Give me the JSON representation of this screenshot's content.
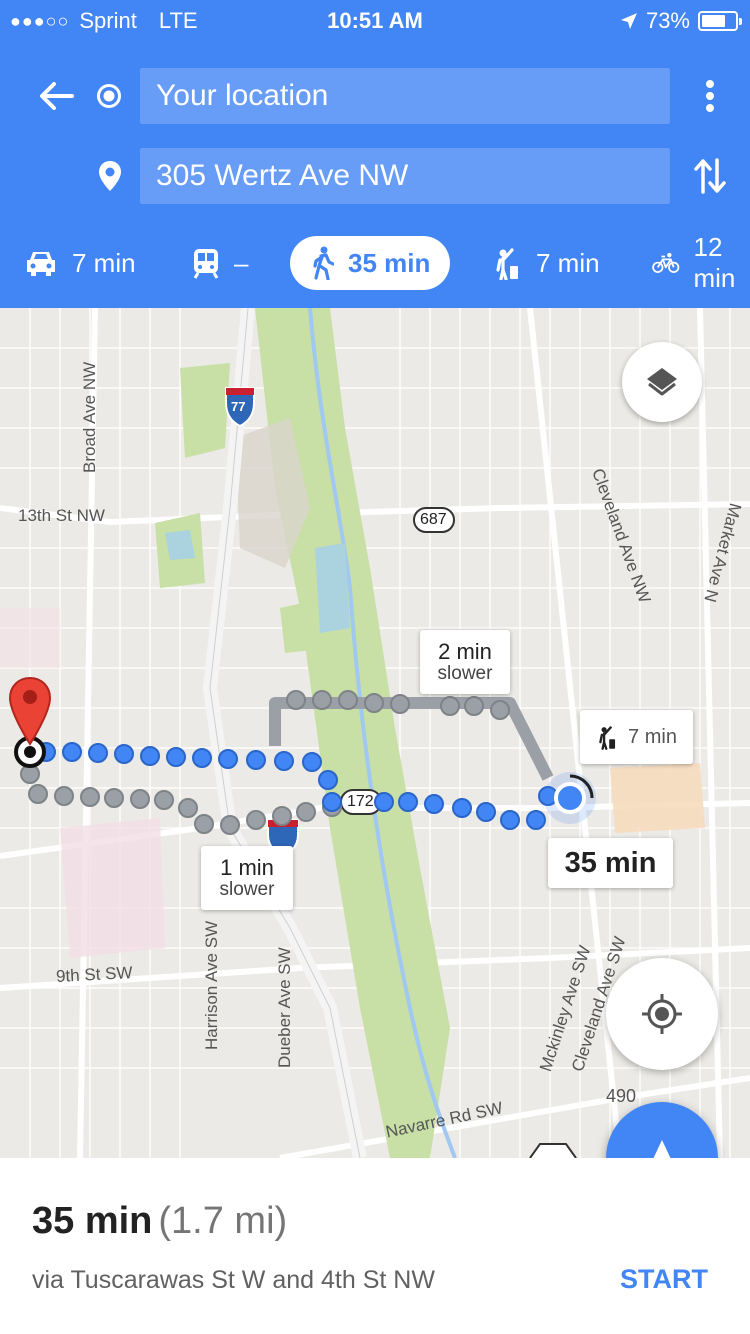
{
  "status_bar": {
    "carrier": "Sprint",
    "network": "LTE",
    "time": "10:51 AM",
    "battery": "73%",
    "battery_level": 0.73
  },
  "directions": {
    "origin": "Your location",
    "destination": "305 Wertz Ave NW"
  },
  "modes": [
    {
      "icon": "car-icon",
      "label": "7 min"
    },
    {
      "icon": "transit-icon",
      "label": "–"
    },
    {
      "icon": "walk-icon",
      "label": "35 min",
      "active": true
    },
    {
      "icon": "ride-icon",
      "label": "7 min"
    },
    {
      "icon": "bike-icon",
      "label": "12 min"
    }
  ],
  "map": {
    "street_labels": {
      "broad_ave": "Broad Ave NW",
      "thirteenth": "13th St NW",
      "cleveland_nw": "Cleveland Ave NW",
      "market": "Market Ave N",
      "ninth": "9th St SW",
      "harrison": "Harrison Ave SW",
      "dueber": "Dueber Ave SW",
      "mckinley": "Mckinley Ave SW",
      "cleveland_sw": "Cleveland Ave SW",
      "navarre": "Navarre Rd SW"
    },
    "shields": {
      "i77": "77",
      "r687": "687",
      "r172": "172",
      "r490": "490"
    },
    "callouts": {
      "alt1_time": "2 min",
      "alt1_note": "slower",
      "alt2_time": "1 min",
      "alt2_note": "slower",
      "ride_time": "7 min",
      "route_time": "35 min"
    }
  },
  "summary": {
    "duration": "35 min",
    "distance": "(1.7 mi)",
    "via": "via Tuscarawas St W and 4th St NW",
    "start": "START"
  },
  "colors": {
    "header": "#4285f4",
    "route": "#4285f4",
    "alt_route": "#9aa0a6",
    "park": "#c8dfa6",
    "marker": "#ea4335"
  }
}
